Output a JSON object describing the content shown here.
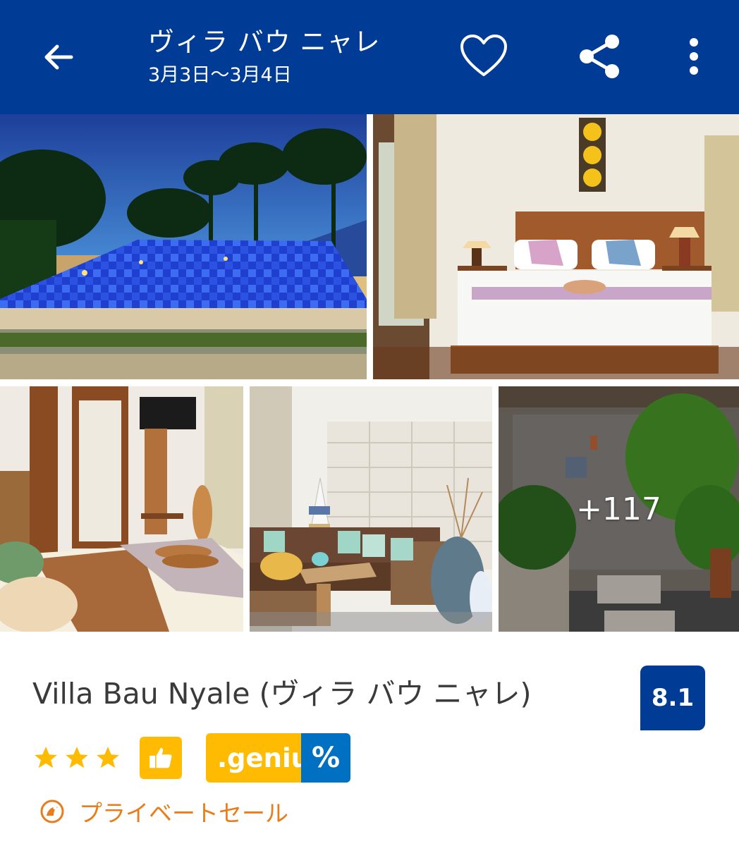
{
  "header": {
    "title": "ヴィラ バウ ニャレ",
    "dates": "3月3日〜3月4日",
    "back_icon": "arrow-left-icon",
    "favorite_icon": "heart-outline-icon",
    "share_icon": "share-icon",
    "more_icon": "more-vertical-icon"
  },
  "gallery": {
    "photos": [
      "pool",
      "bedroom",
      "bedroom-tv",
      "lounge",
      "outdoor-bathroom"
    ],
    "more_count": "+117"
  },
  "property": {
    "name": "Villa Bau Nyale (ヴィラ バウ ニャレ)",
    "score": "8.1",
    "stars": 3,
    "genius_label": ".genius",
    "genius_pct": "%",
    "sale_label": "プライベートセール"
  },
  "colors": {
    "brand_blue": "#003b95",
    "genius_yellow": "#febb02",
    "genius_blue": "#0071c2",
    "sale_orange": "#e97d1b",
    "star_yellow": "#febb02"
  }
}
